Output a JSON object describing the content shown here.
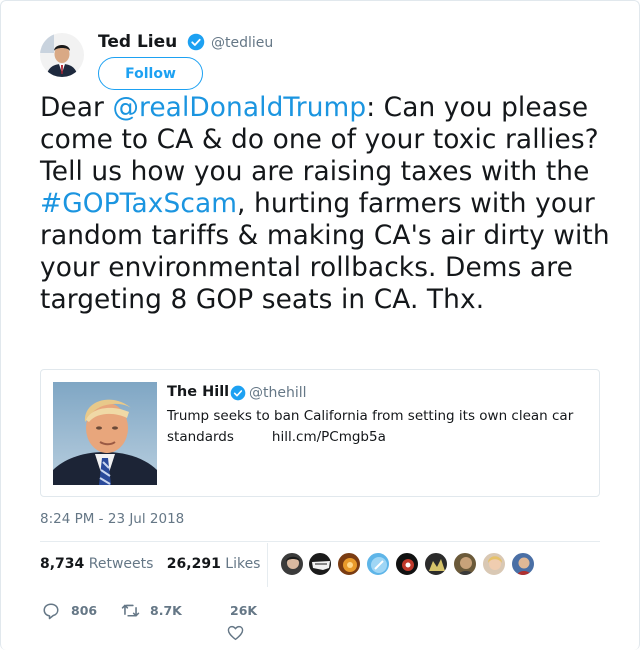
{
  "author": {
    "name": "Ted Lieu",
    "handle": "@tedlieu",
    "follow_label": "Follow"
  },
  "tweet": {
    "segments": [
      {
        "text": "Dear ",
        "link": false
      },
      {
        "text": "@realDonaldTrump",
        "link": true
      },
      {
        "text": ": Can you please come to CA & do one of your toxic rallies? Tell us how you are raising taxes with the ",
        "link": false
      },
      {
        "text": "#GOPTaxScam",
        "link": true
      },
      {
        "text": ", hurting farmers with your random tariffs & making CA's air dirty with your environmental rollbacks. Dems are targeting 8 GOP seats in CA. Thx.",
        "link": false
      }
    ]
  },
  "quote": {
    "name": "The Hill",
    "handle": "@thehill",
    "text": "Trump seeks to ban California from setting its own clean car standards",
    "link": "hill.cm/PCmgb5a"
  },
  "timestamp": "8:24 PM - 23 Jul 2018",
  "stats": {
    "retweets_count": "8,734",
    "retweets_label": "Retweets",
    "likes_count": "26,291",
    "likes_label": "Likes"
  },
  "actions": {
    "replies": "806",
    "retweets": "8.7K",
    "likes": "26K"
  },
  "colors": {
    "link": "#1b95e0",
    "verified": "#1da1f2",
    "muted": "#657786"
  }
}
